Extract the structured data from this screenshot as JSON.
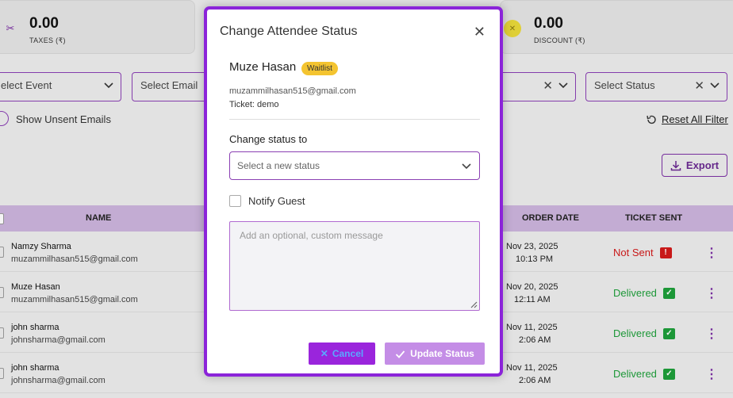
{
  "stats": {
    "taxes": {
      "value": "0.00",
      "label": "TAXES (₹)",
      "icon": "scissors-icon"
    },
    "discount": {
      "value": "0.00",
      "label": "DISCOUNT (₹)",
      "icon": "coin-icon"
    }
  },
  "filters": {
    "event": "elect Event",
    "email": "Select Email",
    "status": "Select Status",
    "show_unsent": "Show Unsent Emails",
    "reset": "Reset All Filter"
  },
  "export_label": "Export",
  "table": {
    "headers": {
      "name": "NAME",
      "order_date": "ORDER DATE",
      "ticket_sent": "TICKET SENT"
    },
    "rows": [
      {
        "name": "Namzy Sharma",
        "email": "muzammilhasan515@gmail.com",
        "date": "Nov 23, 2025",
        "time": "10:13 PM",
        "status": "Not Sent",
        "status_color": "#d11a1a"
      },
      {
        "name": "Muze Hasan",
        "email": "muzammilhasan515@gmail.com",
        "date": "Nov 20, 2025",
        "time": "12:11 AM",
        "status": "Delivered",
        "status_color": "#1e9e3a"
      },
      {
        "name": "john sharma",
        "email": "johnsharma@gmail.com",
        "date": "Nov 11, 2025",
        "time": "2:06 AM",
        "status": "Delivered",
        "status_color": "#1e9e3a"
      },
      {
        "name": "john sharma",
        "email": "johnsharma@gmail.com",
        "date": "Nov 11, 2025",
        "time": "2:06 AM",
        "status": "Delivered",
        "status_color": "#1e9e3a"
      }
    ]
  },
  "modal": {
    "title": "Change Attendee Status",
    "attendee_name": "Muze Hasan",
    "badge": "Waitlist",
    "email": "muzammilhasan515@gmail.com",
    "ticket_label": "Ticket:",
    "ticket_value": "demo",
    "change_label": "Change status to",
    "select_placeholder": "Select a new status",
    "notify_label": "Notify Guest",
    "message_placeholder": "Add an optional, custom message",
    "cancel_label": "Cancel",
    "update_label": "Update Status"
  },
  "colors": {
    "accent": "#8b24d9",
    "badge": "#f4c430",
    "not_sent": "#d11a1a",
    "delivered": "#1e9e3a"
  }
}
